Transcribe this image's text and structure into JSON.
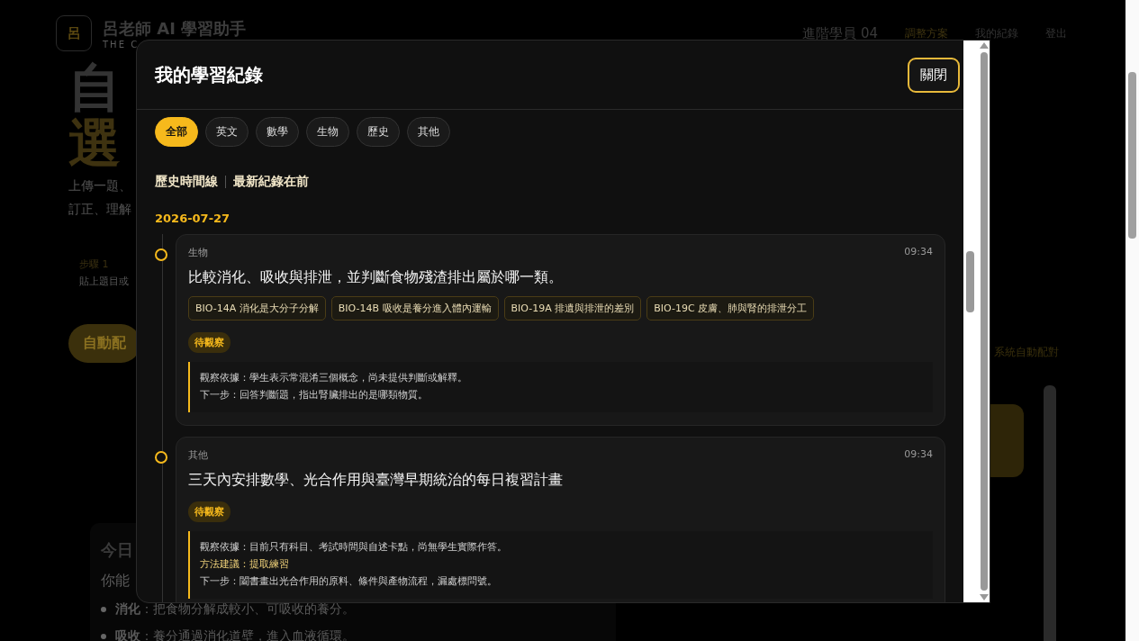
{
  "background": {
    "logo": "呂",
    "brand": "呂老師 AI 學習助手",
    "brand_sub": "THE C",
    "nav": [
      {
        "label": "進階學員 04",
        "kind": "user"
      },
      {
        "label": "調整方案",
        "kind": "accent"
      },
      {
        "label": "我的紀錄",
        "kind": "link"
      },
      {
        "label": "登出",
        "kind": "link"
      }
    ],
    "headline": [
      "自",
      "選"
    ],
    "intro": [
      "上傳一題、",
      "訂正、理解"
    ],
    "step_label": "步驟 1",
    "step_text": "貼上題目或",
    "auto_button": "自動配",
    "auto_note": "系統自動配對",
    "today_title": "今日",
    "today_text": "你能",
    "bullets": [
      "**消化**：把食物分解成較小、可吸收的養分。",
      "**吸收**：養分通過消化道壁，進入血液循環。"
    ]
  },
  "modal": {
    "title": "我的學習紀錄",
    "close": "關閉",
    "filters": [
      {
        "label": "全部",
        "selected": true
      },
      {
        "label": "英文",
        "selected": false
      },
      {
        "label": "數學",
        "selected": false
      },
      {
        "label": "生物",
        "selected": false
      },
      {
        "label": "歷史",
        "selected": false
      },
      {
        "label": "其他",
        "selected": false
      }
    ],
    "heading": "歷史時間線",
    "sort": "最新紀錄在前",
    "date": "2026-07-27",
    "records": [
      {
        "subject": "生物",
        "time": "09:34",
        "title": "比較消化、吸收與排泄，並判斷食物殘渣排出屬於哪一類。",
        "tags": [
          "BIO-14A 消化是大分子分解",
          "BIO-14B 吸收是養分進入體內運輸",
          "BIO-19A 排遺與排泄的差別",
          "BIO-19C 皮膚、肺與腎的排泄分工"
        ],
        "status": "待觀察",
        "notes": [
          {
            "kind": "plain",
            "text": "觀察依據：學生表示常混淆三個概念，尚未提供判斷或解釋。"
          },
          {
            "kind": "plain",
            "text": "下一步：回答判斷題，指出腎臟排出的是哪類物質。"
          }
        ]
      },
      {
        "subject": "其他",
        "time": "09:34",
        "title": "三天內安排數學、光合作用與臺灣早期統治的每日複習計畫",
        "status": "待觀察",
        "notes": [
          {
            "kind": "plain",
            "text": "觀察依據：目前只有科目、考試時間與自述卡點，尚無學生實際作答。"
          },
          {
            "kind": "method",
            "text": "方法建議：提取練習"
          },
          {
            "kind": "plain",
            "text": "下一步：闔書畫出光合作用的原料、條件與產物流程，漏處標問號。"
          }
        ]
      }
    ]
  }
}
